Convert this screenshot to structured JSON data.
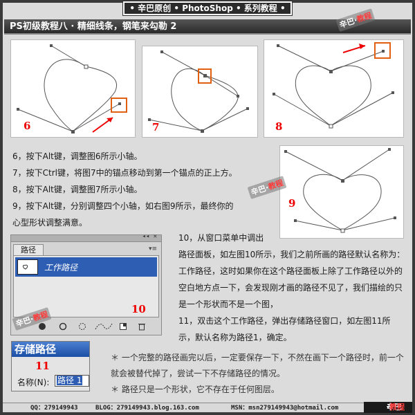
{
  "banner": {
    "text": "• 辛巴原创 • PhotoShop • 系列教程 •"
  },
  "title": {
    "text": "PS初级教程八 · 精细线条，钢笔来勾勒 2"
  },
  "watermark": {
    "prefix": "辛巴",
    "suffix": "教程"
  },
  "figures": [
    {
      "label": "6"
    },
    {
      "label": "7"
    },
    {
      "label": "8"
    },
    {
      "label": "9"
    },
    {
      "label": "10"
    },
    {
      "label": "11"
    }
  ],
  "steps": [
    "6，按下Alt键，调整图6所示小轴。",
    "7，按下Ctrl键，将图7中的锚点移动到第一个锚点的正上方。",
    "8，按下Alt键，调整图7所示小轴。",
    "9，按下Alt键，分别调整四个小轴，如右图9所示，最终你的",
    "心型形状调整满意。"
  ],
  "description": {
    "p1_line1": "10，从窗口菜单中调出",
    "p1_rest": "路径面板，如左图10所示，我们之前所画的路径默认名称为：工作路径，这时如果你在这个路径面板上除了工作路径以外的空白地方点一下，会发现刚才画的路径不见了，我们描绘的只是一个形状而不是一个图，",
    "p2": "11，双击这个工作路径，弹出存储路径窗口，如左图11所示，默认名称为路径1，确定。"
  },
  "paths_panel": {
    "tab": "路径",
    "menu_icon": "▾≡",
    "header_controls": "◂◂ ✕",
    "row_label": "工作路径"
  },
  "save_dialog": {
    "title": "存储路径",
    "name_label": "名称(N):",
    "name_value": "路径 1"
  },
  "notes": [
    "＊ 一个完整的路径画完以后，一定要保存一下，不然在画下一个路径时，前一个就会被替代掉了，尝试一下不存储路径的情况。",
    "＊ 路径只是一个形状，它不存在于任何图层。"
  ],
  "footer": {
    "qq": "QQ：279149943",
    "blog": "BLOG：279149943.blog.163.com",
    "msn": "MSN：msn279149943@hotmail.com",
    "brand_prefix": "辛巴",
    "brand_suffix": "教程"
  },
  "colors": {
    "accent_red": "#e00000",
    "highlight_orange": "#e06010",
    "selection_blue": "#2e5db4"
  }
}
